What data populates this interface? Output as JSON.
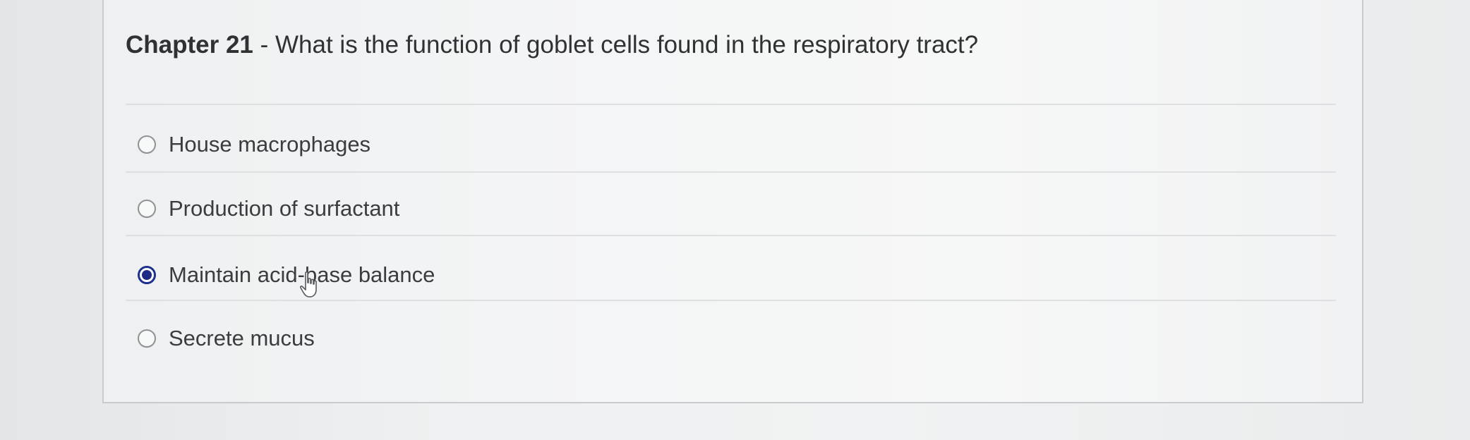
{
  "question": {
    "chapter": "Chapter 21",
    "separator": " - ",
    "text": "What is the function of goblet cells found in the respiratory tract?"
  },
  "options": [
    {
      "label": "House macrophages",
      "selected": false
    },
    {
      "label": "Production of surfactant",
      "selected": false
    },
    {
      "label": "Maintain acid-base balance",
      "selected": true
    },
    {
      "label": "Secrete mucus",
      "selected": false
    }
  ],
  "colors": {
    "selected_radio": "#1b2b86",
    "text": "#2f3133"
  },
  "icons": {
    "cursor": "hand-pointer-icon"
  }
}
